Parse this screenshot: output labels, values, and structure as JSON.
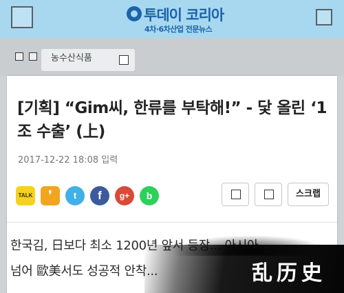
{
  "header": {
    "logo_text": "투데이 코리아",
    "logo_subtitle": "4차·6차산업 전문뉴스",
    "menu_icon": "menu-icon",
    "search_icon": "search-icon",
    "bg_color": "#a7d8f0",
    "brand_color": "#1b62a8"
  },
  "category": {
    "label": "농수산식품"
  },
  "article": {
    "headline": "[기획] “Gim씨, 한류를 부탁해!” - 닻 올린 ‘1조 수출’ (上)",
    "date": "2017-12-22 18:08 입력",
    "share_icons": [
      {
        "name": "kakaotalk-icon",
        "glyph": "TALK"
      },
      {
        "name": "kakaostory-icon",
        "glyph": "❜"
      },
      {
        "name": "twitter-icon",
        "glyph": "t"
      },
      {
        "name": "facebook-icon",
        "glyph": "f"
      },
      {
        "name": "google-plus-icon",
        "glyph": "g+"
      },
      {
        "name": "band-icon",
        "glyph": "b"
      }
    ],
    "scrap_label": "스크랩",
    "body_lines": [
      "한국김, 日보다 최소 1200년 앞서 등장... 아시아",
      "넘어 歐美서도 성공적 안착..."
    ]
  },
  "watermark": {
    "text": "乱历史"
  }
}
